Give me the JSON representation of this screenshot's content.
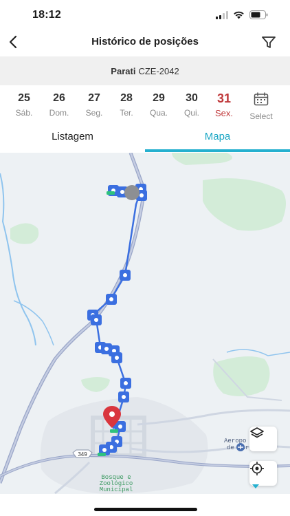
{
  "status": {
    "time": "18:12"
  },
  "header": {
    "title": "Histórico de posições"
  },
  "vehicle": {
    "name": "Parati",
    "plate": "CZE-2042"
  },
  "dates": [
    {
      "num": "25",
      "day": "Sáb."
    },
    {
      "num": "26",
      "day": "Dom."
    },
    {
      "num": "27",
      "day": "Seg."
    },
    {
      "num": "28",
      "day": "Ter."
    },
    {
      "num": "29",
      "day": "Qua."
    },
    {
      "num": "30",
      "day": "Qui."
    },
    {
      "num": "31",
      "day": "Sex.",
      "active": true
    }
  ],
  "select_label": "Select",
  "tabs": {
    "list": "Listagem",
    "map": "Mapa"
  },
  "map": {
    "road_label": "349",
    "poi_zoo_line1": "Bosque e",
    "poi_zoo_line2": "Zoológico",
    "poi_zoo_line3": "Municipal",
    "poi_airport_line1": "Aeropo",
    "poi_airport_line2": "de Gar"
  },
  "colors": {
    "accent": "#25b0cf",
    "active_date": "#c0393b",
    "route": "#3b6fe0",
    "marker_end": "#d9363e"
  }
}
